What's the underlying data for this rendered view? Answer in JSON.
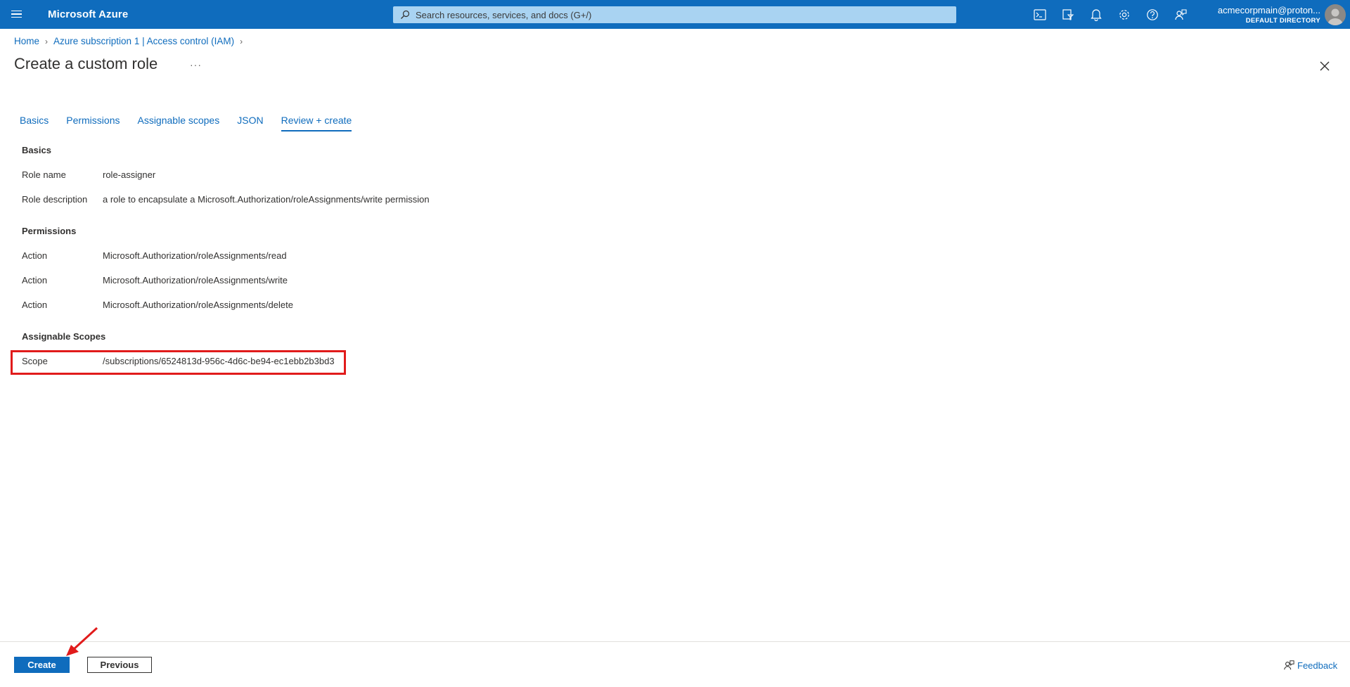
{
  "topbar": {
    "brand": "Microsoft Azure",
    "search_placeholder": "Search resources, services, and docs (G+/)",
    "icons": [
      "cloud-shell-icon",
      "directory-filter-icon",
      "bell-icon",
      "gear-icon",
      "help-icon",
      "feedback-icon"
    ],
    "account_email": "acmecorpmain@proton...",
    "account_directory": "DEFAULT DIRECTORY"
  },
  "breadcrumb": {
    "items": [
      "Home",
      "Azure subscription 1 | Access control (IAM)"
    ]
  },
  "page": {
    "title": "Create a custom role",
    "more": "···"
  },
  "tabs": [
    {
      "label": "Basics",
      "active": false
    },
    {
      "label": "Permissions",
      "active": false
    },
    {
      "label": "Assignable scopes",
      "active": false
    },
    {
      "label": "JSON",
      "active": false
    },
    {
      "label": "Review + create",
      "active": true
    }
  ],
  "review": {
    "basics": {
      "heading": "Basics",
      "rows": [
        {
          "label": "Role name",
          "value": "role-assigner"
        },
        {
          "label": "Role description",
          "value": "a role to encapsulate a Microsoft.Authorization/roleAssignments/write permission"
        }
      ]
    },
    "permissions": {
      "heading": "Permissions",
      "rows": [
        {
          "label": "Action",
          "value": "Microsoft.Authorization/roleAssignments/read"
        },
        {
          "label": "Action",
          "value": "Microsoft.Authorization/roleAssignments/write"
        },
        {
          "label": "Action",
          "value": "Microsoft.Authorization/roleAssignments/delete"
        }
      ]
    },
    "scopes": {
      "heading": "Assignable Scopes",
      "rows": [
        {
          "label": "Scope",
          "value": "/subscriptions/6524813d-956c-4d6c-be94-ec1ebb2b3bd3"
        }
      ]
    }
  },
  "footer": {
    "create_label": "Create",
    "previous_label": "Previous",
    "feedback_label": "Feedback"
  },
  "colors": {
    "brand": "#0f6cbd",
    "highlight": "#e11b1b"
  }
}
